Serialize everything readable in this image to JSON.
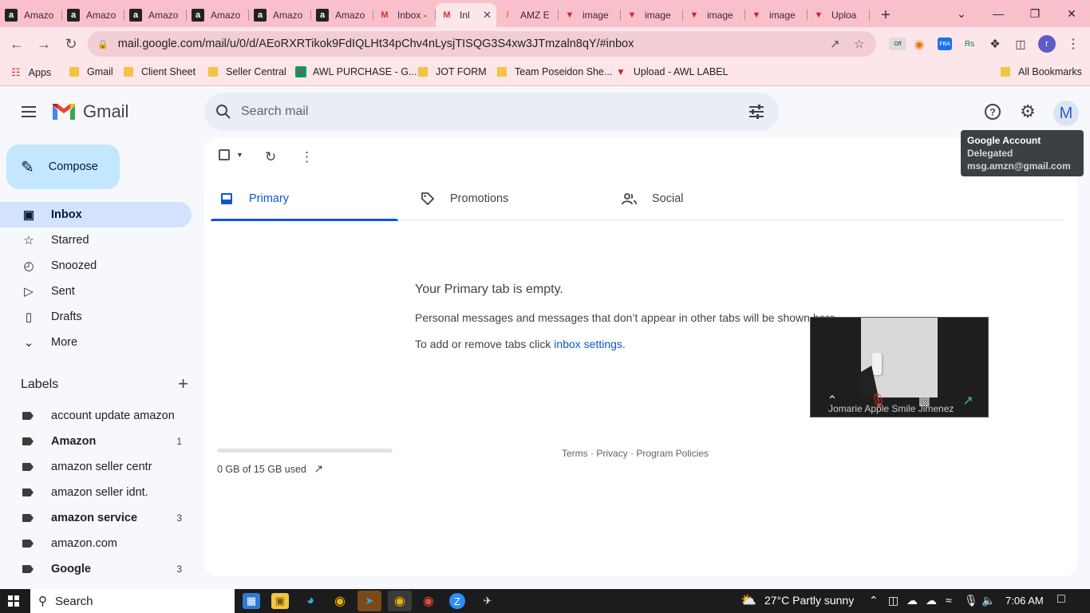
{
  "browser": {
    "tabs": [
      {
        "title": "Amazo",
        "fav": "a"
      },
      {
        "title": "Amazo",
        "fav": "a"
      },
      {
        "title": "Amazo",
        "fav": "a"
      },
      {
        "title": "Amazo",
        "fav": "a"
      },
      {
        "title": "Amazo",
        "fav": "a"
      },
      {
        "title": "Amazo",
        "fav": "a"
      },
      {
        "title": "Inbox -",
        "fav": "m"
      },
      {
        "title": "Inl",
        "fav": "m",
        "active": true
      },
      {
        "title": "AMZ E",
        "fav": "z"
      },
      {
        "title": "image",
        "fav": "v"
      },
      {
        "title": "image",
        "fav": "v"
      },
      {
        "title": "image",
        "fav": "v"
      },
      {
        "title": "image",
        "fav": "v"
      },
      {
        "title": "Uploa",
        "fav": "v"
      }
    ],
    "url": "mail.google.com/mail/u/0/d/AEoRXRTikok9FdIQLHt34pChv4nLysjTISQG3S4xw3JTmzaln8qY/#inbox",
    "bookmarks": [
      {
        "label": "Apps",
        "icon": "apps-grid-icon"
      },
      {
        "label": "Gmail",
        "icon": "folder-icon"
      },
      {
        "label": "Client Sheet",
        "icon": "folder-icon"
      },
      {
        "label": "Seller Central",
        "icon": "folder-icon"
      },
      {
        "label": "AWL PURCHASE - G...",
        "icon": "sheets-icon"
      },
      {
        "label": "JOT FORM",
        "icon": "folder-icon"
      },
      {
        "label": "Team Poseidon She...",
        "icon": "folder-icon"
      },
      {
        "label": "Upload - AWL LABEL",
        "icon": "vivaldi-icon"
      }
    ],
    "all_bookmarks": "All Bookmarks",
    "ext_off": "Off",
    "profile_initial": "r"
  },
  "gmail": {
    "logo_text": "Gmail",
    "search_placeholder": "Search mail",
    "avatar_initial": "M",
    "tooltip": {
      "title": "Google Account",
      "line1": "Delegated",
      "line2": "msg.amzn@gmail.com"
    },
    "compose_label": "Compose",
    "nav": [
      {
        "label": "Inbox",
        "icon": "inbox-icon",
        "selected": true
      },
      {
        "label": "Starred",
        "icon": "star-icon"
      },
      {
        "label": "Snoozed",
        "icon": "clock-icon"
      },
      {
        "label": "Sent",
        "icon": "send-icon"
      },
      {
        "label": "Drafts",
        "icon": "draft-icon"
      },
      {
        "label": "More",
        "icon": "chevron-down-icon"
      }
    ],
    "labels_title": "Labels",
    "labels": [
      {
        "name": "account update amazon",
        "count": "",
        "bold": false
      },
      {
        "name": "Amazon",
        "count": "1",
        "bold": true
      },
      {
        "name": "amazon seller centr",
        "count": "",
        "bold": false
      },
      {
        "name": "amazon seller idnt.",
        "count": "",
        "bold": false
      },
      {
        "name": "amazon service",
        "count": "3",
        "bold": true
      },
      {
        "name": "amazon.com",
        "count": "",
        "bold": false
      },
      {
        "name": "Google",
        "count": "3",
        "bold": true
      }
    ],
    "tabs": [
      {
        "label": "Primary",
        "icon": "inbox-tray-icon",
        "selected": true
      },
      {
        "label": "Promotions",
        "icon": "tag-icon"
      },
      {
        "label": "Social",
        "icon": "people-icon"
      }
    ],
    "empty": {
      "heading": "Your Primary tab is empty.",
      "line1": "Personal messages and messages that don’t appear in other tabs will be shown here.",
      "line2_prefix": "To add or remove tabs click ",
      "line2_link": "inbox settings",
      "line2_suffix": "."
    },
    "storage": "0 GB of 15 GB used",
    "footer": "Terms · Privacy · Program Policies"
  },
  "video_call": {
    "participant": "Jomarie Apple Smile Jimenez"
  },
  "taskbar": {
    "search_label": "Search",
    "weather": "27°C  Partly sunny",
    "time": "7:06 AM"
  },
  "colors": {
    "chrome_tabbar": "#f9c0cb",
    "chrome_toolbar": "#fde6ea",
    "gmail_bg": "#f6f8fc",
    "compose": "#c2e7ff",
    "nav_selected": "#d3e3fd",
    "accent": "#0b57d0"
  }
}
